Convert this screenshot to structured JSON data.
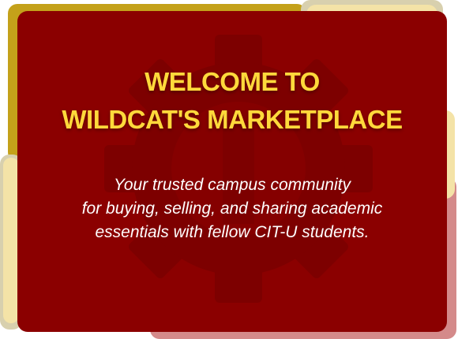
{
  "hero": {
    "title_lines": [
      "WELCOME TO",
      "WILDCAT'S MARKETPLACE"
    ],
    "subtitle_lines": [
      "Your trusted campus community",
      "for buying, selling, and sharing academic",
      "essentials with fellow CIT-U students."
    ]
  },
  "colors": {
    "card": "#8b0000",
    "title": "#ffd93b",
    "subtitle": "#ffffff",
    "accent_gold": "#c4a11a",
    "accent_cream": "#f4e3a7",
    "accent_pink": "#d48a8a"
  },
  "icons": {
    "watermark": "gear-logo-icon"
  }
}
